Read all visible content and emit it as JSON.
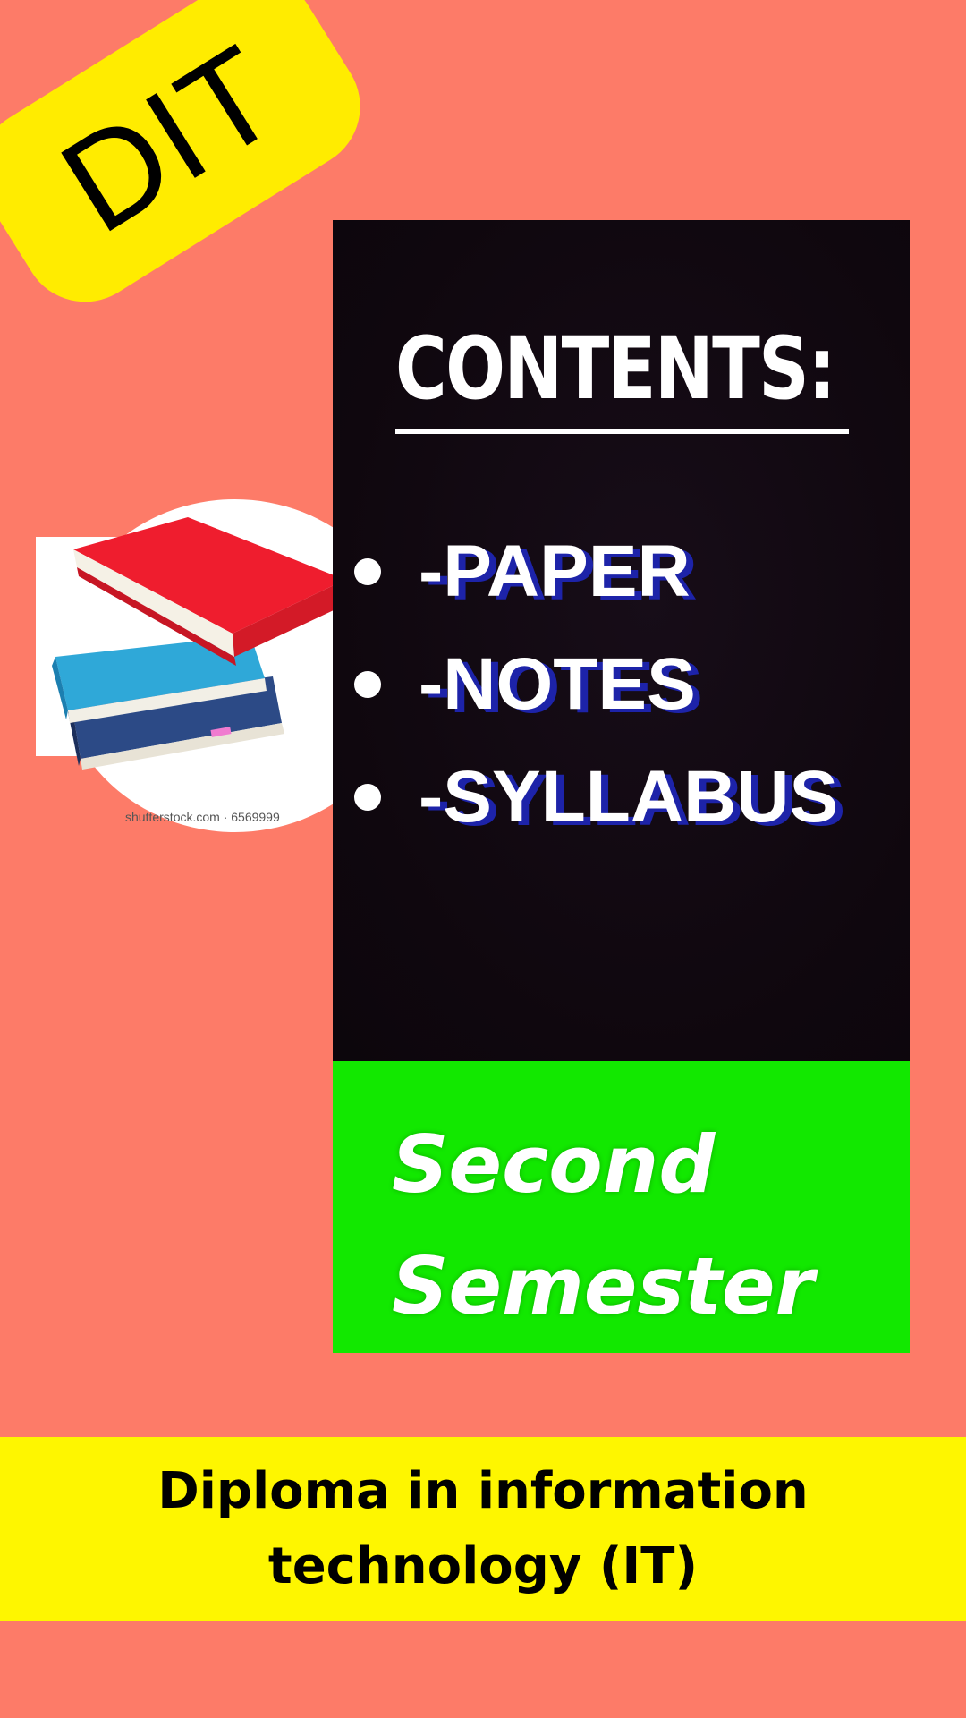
{
  "badge": {
    "text": "DIT"
  },
  "image": {
    "watermark": "shutterstock.com · 6569999"
  },
  "contents": {
    "title": "CONTENTS:",
    "items": [
      {
        "label": "-PAPER"
      },
      {
        "label": "-NOTES"
      },
      {
        "label": "-SYLLABUS"
      }
    ]
  },
  "semester": {
    "line1": "Second",
    "line2": "Semester"
  },
  "footer": {
    "line1": "Diploma in information",
    "line2": "technology (IT)"
  },
  "colors": {
    "background": "#fd7b68",
    "badge": "#ffec00",
    "contents_panel": "#0f070e",
    "semester_panel": "#12e800",
    "footer_band": "#fef600",
    "item_shadow": "#1d23a9"
  },
  "icons": {
    "books": "stack-of-books-icon"
  }
}
